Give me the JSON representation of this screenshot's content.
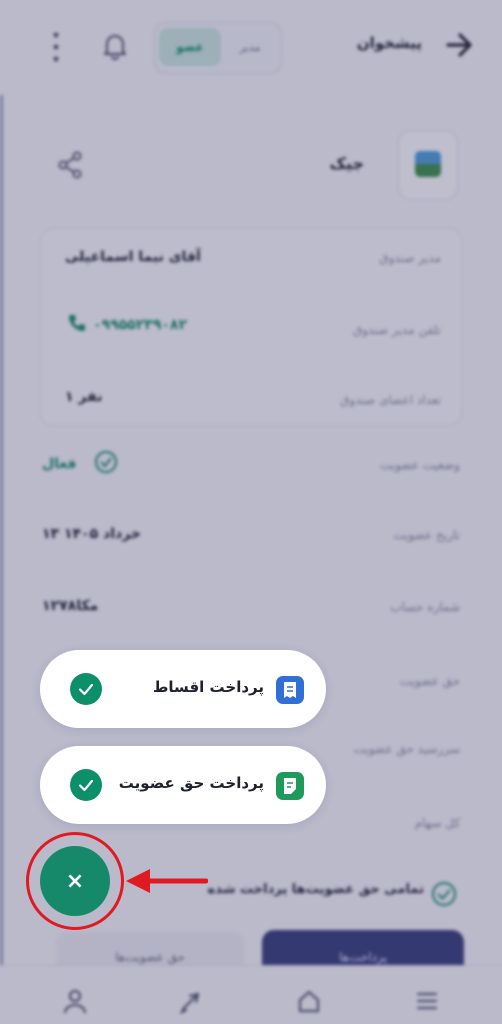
{
  "header": {
    "title": "پیشخوان",
    "role_switch": {
      "active": "عضو",
      "inactive": "مدیر"
    }
  },
  "group": {
    "name": "جیک"
  },
  "info_card": {
    "rows": [
      {
        "label": "مدیر صندوق",
        "value": "آقای نیما اسماعیلی"
      },
      {
        "label": "تلفن مدیر صندوق",
        "value": "۰۹۹۵۵۲۳۹۰۸۲"
      },
      {
        "label": "تعداد اعضای صندوق",
        "value": "۱ نفر"
      }
    ]
  },
  "details": [
    {
      "label": "وضعیت عضویت",
      "value": "فعال"
    },
    {
      "label": "تاریخ عضویت",
      "value": "۱۳ خرداد ۱۴۰۵"
    },
    {
      "label": "شماره حساب",
      "value": "۱۲۷۸مکا"
    },
    {
      "label": "حق عضویت",
      "value": ""
    },
    {
      "label": "سررسید حق عضویت",
      "value": ""
    },
    {
      "label": "کل سهام",
      "value": ""
    }
  ],
  "all_paid_text": "تمامی حق عضویت‌ها پرداخت شده",
  "buttons": {
    "primary": "پرداخت‌ها",
    "secondary": "حق عضویت‌ها"
  },
  "fab_menu": {
    "items": [
      {
        "label": "پرداخت اقساط",
        "icon": "receipt-icon",
        "icon_color": "#2f6fd6"
      },
      {
        "label": "پرداخت حق عضویت",
        "icon": "document-icon",
        "icon_color": "#1f9a5a"
      }
    ],
    "close_symbol": "×"
  },
  "colors": {
    "accent": "#17896b",
    "highlight": "#e01a22",
    "primary": "#3a3f7a"
  }
}
